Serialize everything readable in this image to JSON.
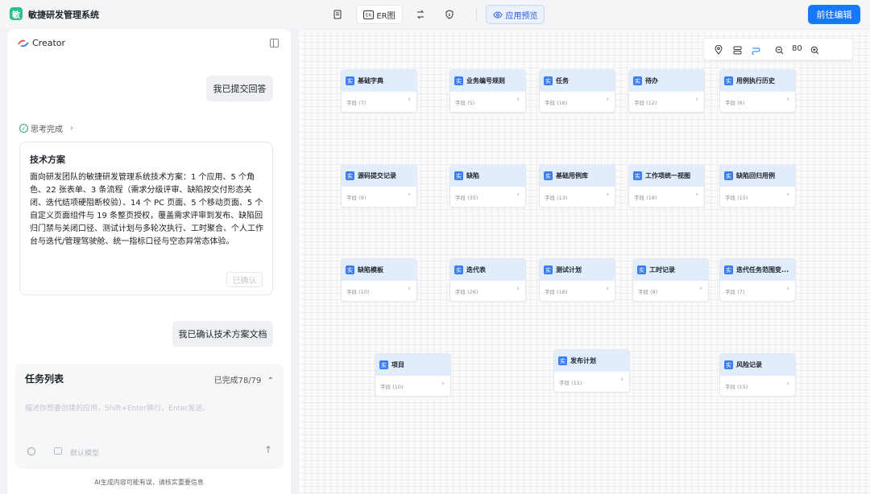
{
  "app": {
    "logo_char": "敏",
    "title": "敏捷研发管理系统"
  },
  "toolbar": {
    "doc_icon": "document-icon",
    "er_label": "ER图",
    "flow_icon": "flow-icon",
    "shield_icon": "shield-icon",
    "preview_label": "应用预览",
    "go_edit_label": "前往编辑"
  },
  "chat": {
    "creator_label": "Creator",
    "msg_user_1": "我已提交回答",
    "thinking_label": "思考完成",
    "plan_title": "技术方案",
    "plan_body": "面向研发团队的敏捷研发管理系统技术方案：1 个应用、5 个角色、22 张表单、3 条流程（需求分级评审、缺陷按交付形态关闭、迭代结项硬阻断校验）、14 个 PC 页面、5 个移动页面、5 个自定义页面组件与 19 条整页授权，覆盖需求评审到发布、缺陷回归门禁与关闭口径、测试计划与多轮次执行、工时聚合、个人工作台与迭代/管理驾驶舱、统一指标口径与空态异常态体验。",
    "confirmed_label": "已确认",
    "msg_user_2": "我已确认技术方案文档"
  },
  "tasks": {
    "title": "任务列表",
    "done_text": "已完成78/79",
    "input_placeholder": "描述你想要创建的应用，Shift+Enter换行，Enter发送。",
    "model_label": "默认模型"
  },
  "disclaimer": "AI生成内容可能有误，请核实重要信息",
  "zoom": {
    "value": "80"
  },
  "entity_icon_char": "实",
  "entities": [
    {
      "name": "基础字典",
      "field": "字段 (7)"
    },
    {
      "name": "业务编号规则",
      "field": "字段 (5)"
    },
    {
      "name": "任务",
      "field": "字段 (16)"
    },
    {
      "name": "待办",
      "field": "字段 (12)"
    },
    {
      "name": "用例执行历史",
      "field": "字段 (6)"
    },
    {
      "name": "源码提交记录",
      "field": "字段 (9)"
    },
    {
      "name": "缺陷",
      "field": "字段 (35)"
    },
    {
      "name": "基础用例库",
      "field": "字段 (13)"
    },
    {
      "name": "工作项统一视图",
      "field": "字段 (18)"
    },
    {
      "name": "缺陷回归用例",
      "field": "字段 (15)"
    },
    {
      "name": "缺陷模板",
      "field": "字段 (10)"
    },
    {
      "name": "迭代表",
      "field": "字段 (26)"
    },
    {
      "name": "测试计划",
      "field": "字段 (16)"
    },
    {
      "name": "工时记录",
      "field": "字段 (8)"
    },
    {
      "name": "迭代任务范围变...",
      "field": "字段 (7)"
    },
    {
      "name": "项目",
      "field": "字段 (10)"
    },
    {
      "name": "发布计划",
      "field": "字段 (11)"
    },
    {
      "name": "风险记录",
      "field": "字段 (15)"
    }
  ]
}
